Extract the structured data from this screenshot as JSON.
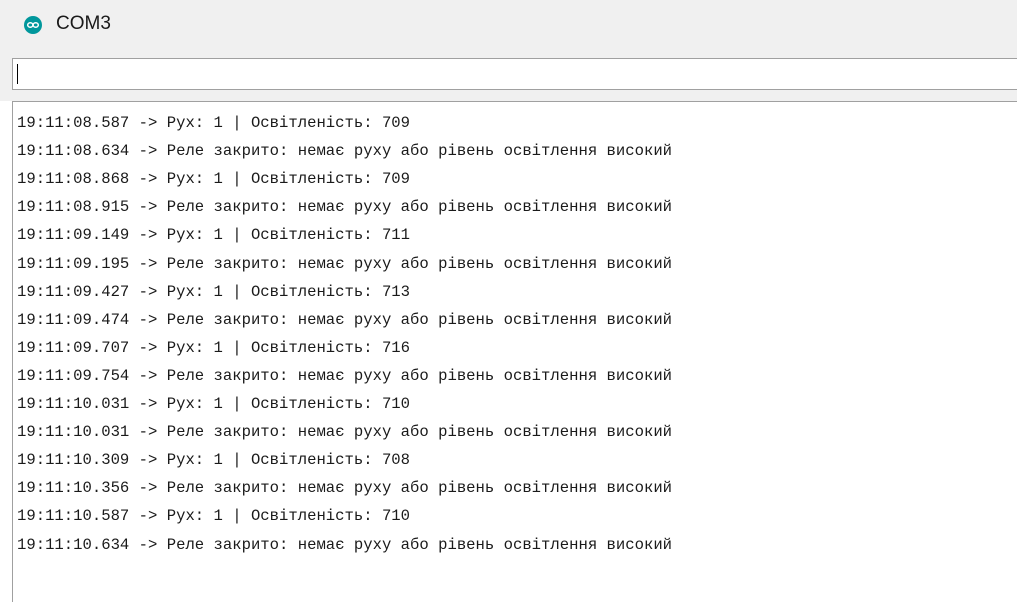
{
  "window": {
    "title": "COM3",
    "icon": "arduino-infinity-icon"
  },
  "send_input": {
    "value": ""
  },
  "log": {
    "lines": [
      "19:11:08.587 -> Рух: 1 | Освітленість: 709",
      "19:11:08.634 -> Реле закрито: немає руху або рівень освітлення високий",
      "19:11:08.868 -> Рух: 1 | Освітленість: 709",
      "19:11:08.915 -> Реле закрито: немає руху або рівень освітлення високий",
      "19:11:09.149 -> Рух: 1 | Освітленість: 711",
      "19:11:09.195 -> Реле закрито: немає руху або рівень освітлення високий",
      "19:11:09.427 -> Рух: 1 | Освітленість: 713",
      "19:11:09.474 -> Реле закрито: немає руху або рівень освітлення високий",
      "19:11:09.707 -> Рух: 1 | Освітленість: 716",
      "19:11:09.754 -> Реле закрито: немає руху або рівень освітлення високий",
      "19:11:10.031 -> Рух: 1 | Освітленість: 710",
      "19:11:10.031 -> Реле закрито: немає руху або рівень освітлення високий",
      "19:11:10.309 -> Рух: 1 | Освітленість: 708",
      "19:11:10.356 -> Реле закрито: немає руху або рівень освітлення високий",
      "19:11:10.587 -> Рух: 1 | Освітленість: 710",
      "19:11:10.634 -> Реле закрито: немає руху або рівень освітлення високий"
    ]
  },
  "colors": {
    "accent": "#00979c",
    "chrome": "#f0f0f0",
    "border": "#a0a0a0"
  }
}
